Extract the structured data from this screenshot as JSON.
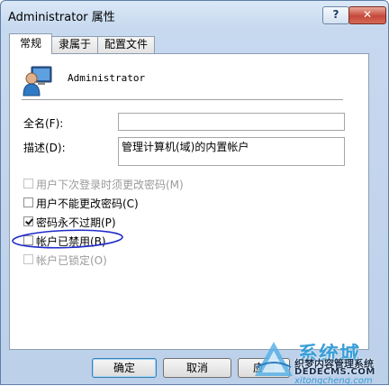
{
  "window": {
    "title": "Administrator 属性",
    "help_label": "?",
    "close_label": "✕"
  },
  "tabs": [
    {
      "label": "常规",
      "active": true
    },
    {
      "label": "隶属于",
      "active": false
    },
    {
      "label": "配置文件",
      "active": false
    }
  ],
  "general": {
    "user_name": "Administrator",
    "full_name_label": "全名(F):",
    "full_name_value": "",
    "description_label": "描述(D):",
    "description_value": "管理计算机(域)的内置帐户"
  },
  "checkboxes": [
    {
      "label": "用户下次登录时须更改密码(M)",
      "checked": false,
      "enabled": false
    },
    {
      "label": "用户不能更改密码(C)",
      "checked": false,
      "enabled": true
    },
    {
      "label": "密码永不过期(P)",
      "checked": true,
      "enabled": true
    },
    {
      "label": "帐户已禁用(B)",
      "checked": false,
      "enabled": true
    },
    {
      "label": "帐户已锁定(O)",
      "checked": false,
      "enabled": false
    }
  ],
  "buttons": {
    "ok": "确定",
    "cancel": "取消",
    "apply": "应用"
  },
  "watermark": {
    "brand": "系统城",
    "line1": "织梦内容管理系统",
    "line2": "DEDECMS.COM",
    "line3": "xitongcheng.com"
  },
  "colors": {
    "titlebar": "#c7d9ef",
    "annotation_circle": "#1f2bc9",
    "close_button": "#c5483a"
  },
  "icons": [
    "user-icon",
    "help-icon",
    "close-icon"
  ]
}
